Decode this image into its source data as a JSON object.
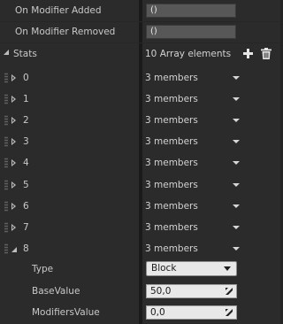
{
  "events": {
    "on_modifier_added": {
      "label": "On Modifier Added",
      "value": "()"
    },
    "on_modifier_removed": {
      "label": "On Modifier Removed",
      "value": "()"
    }
  },
  "stats": {
    "label": "Stats",
    "summary": "10 Array elements",
    "icons": [
      "plus-icon",
      "trash-icon"
    ],
    "elements": [
      {
        "index": "0",
        "value": "3 members"
      },
      {
        "index": "1",
        "value": "3 members"
      },
      {
        "index": "2",
        "value": "3 members"
      },
      {
        "index": "3",
        "value": "3 members"
      },
      {
        "index": "4",
        "value": "3 members"
      },
      {
        "index": "5",
        "value": "3 members"
      },
      {
        "index": "6",
        "value": "3 members"
      },
      {
        "index": "7",
        "value": "3 members"
      },
      {
        "index": "8",
        "value": "3 members"
      }
    ],
    "expanded_element": {
      "type_label": "Type",
      "type_value": "Block",
      "base_label": "BaseValue",
      "base_value": "50,0",
      "modifiers_label": "ModifiersValue",
      "modifiers_value": "0,0"
    }
  }
}
